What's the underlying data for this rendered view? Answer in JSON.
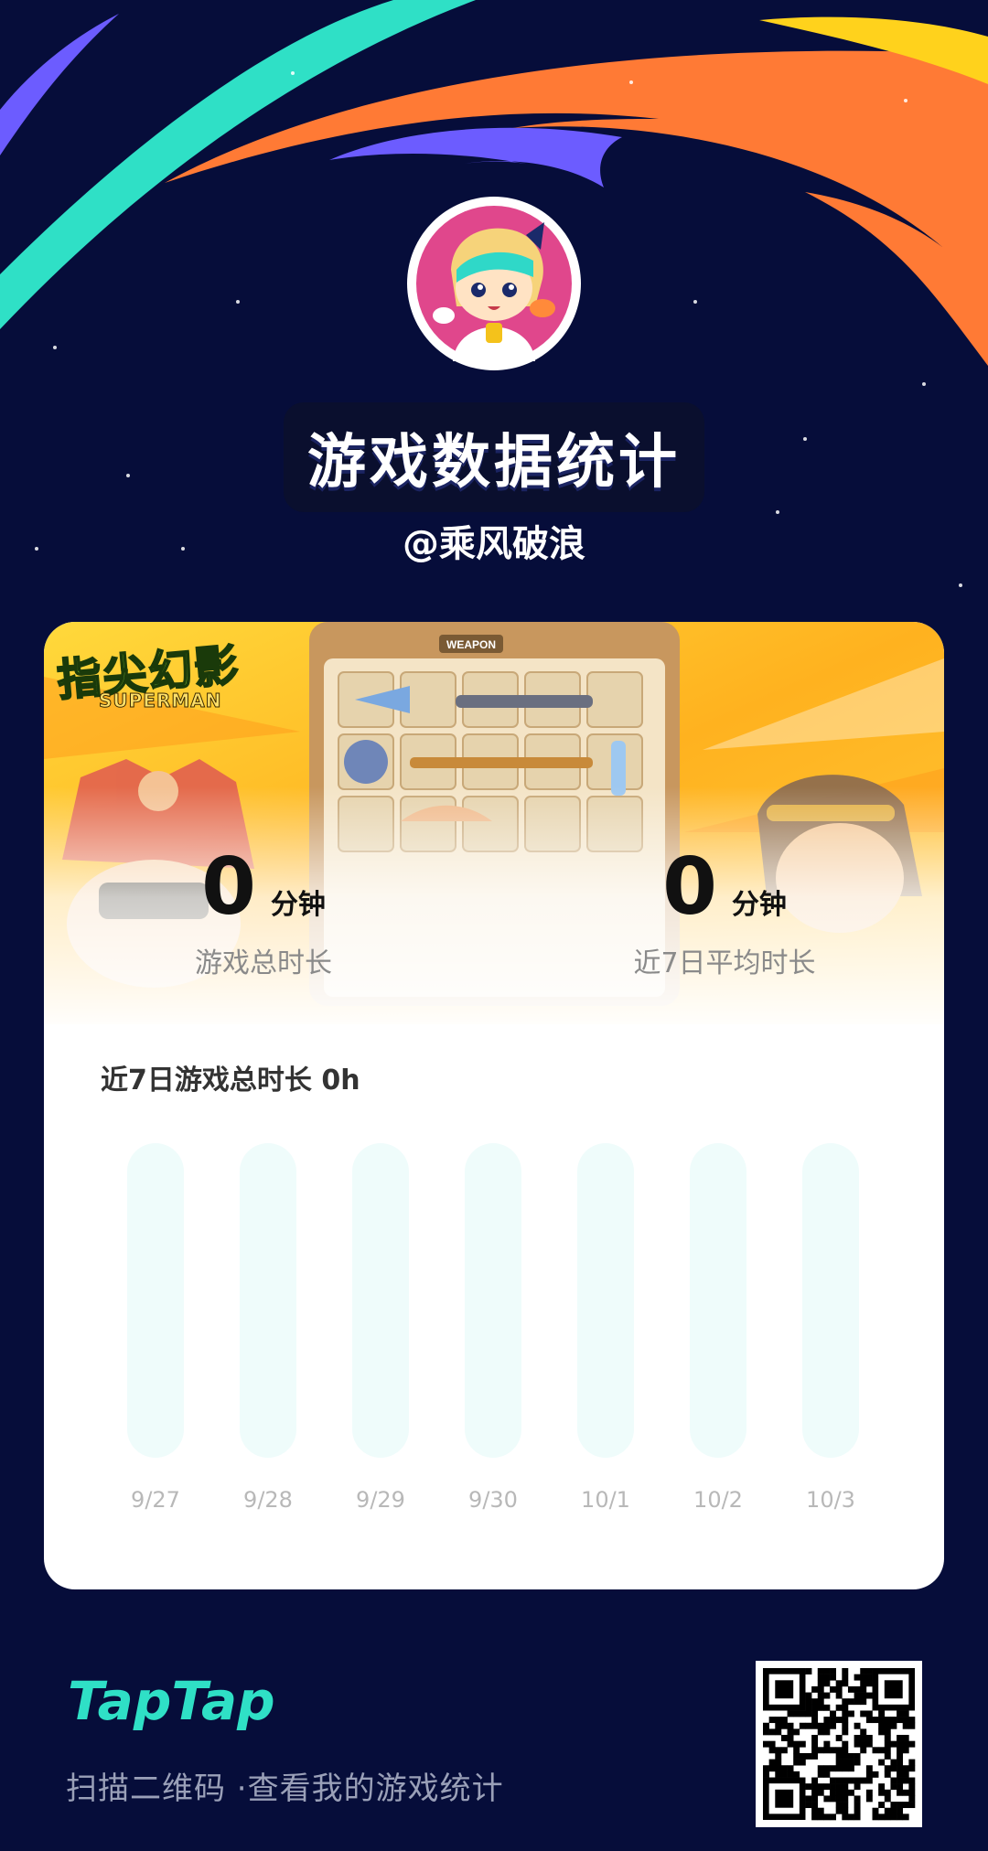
{
  "header": {
    "title": "游戏数据统计",
    "username": "@乘风破浪"
  },
  "avatar": {
    "icon": "taptap-mascot-avatar-icon"
  },
  "card": {
    "game_logo": "指尖幻影",
    "game_logo_sub": "SUPERMAN",
    "banner_tag": "WEAPON",
    "stats": [
      {
        "value": "0",
        "unit": "分钟",
        "label": "游戏总时长"
      },
      {
        "value": "0",
        "unit": "分钟",
        "label": "近7日平均时长"
      }
    ],
    "chart_title": "近7日游戏总时长",
    "chart_total": "0h"
  },
  "chart_data": {
    "type": "bar",
    "categories": [
      "9/27",
      "9/28",
      "9/29",
      "9/30",
      "10/1",
      "10/2",
      "10/3"
    ],
    "values": [
      0,
      0,
      0,
      0,
      0,
      0,
      0
    ],
    "title": "近7日游戏总时长 0h",
    "xlabel": "",
    "ylabel": "",
    "grid": false,
    "track_color": "#effcfb",
    "bar_color": "#1fd6c4"
  },
  "footer": {
    "brand": "TapTap",
    "caption": "扫描二维码 ·查看我的游戏统计",
    "qr_icon": "qr-code-icon"
  },
  "colors": {
    "background": "#060d3a",
    "brand_teal": "#2fe0c6",
    "orange": "#ff7a35",
    "purple": "#6c5cff",
    "yellow": "#ffd21c"
  }
}
